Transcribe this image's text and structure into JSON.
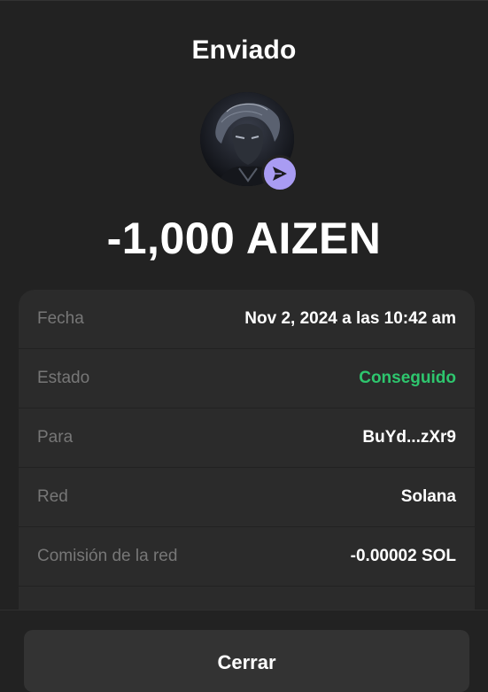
{
  "header": {
    "title": "Enviado"
  },
  "avatar": {
    "badge_icon": "send-icon"
  },
  "amount": "-1,000 AIZEN",
  "details": [
    {
      "label": "Fecha",
      "value": "Nov 2, 2024 a las 10:42 am"
    },
    {
      "label": "Estado",
      "value": "Conseguido"
    },
    {
      "label": "Para",
      "value": "BuYd...zXr9"
    },
    {
      "label": "Red",
      "value": "Solana"
    },
    {
      "label": "Comisión de la red",
      "value": "-0.00002 SOL"
    }
  ],
  "footer": {
    "close_label": "Cerrar"
  },
  "colors": {
    "background": "#222222",
    "card": "#2b2b2b",
    "success": "#2ec66e",
    "badge": "#a99cf3",
    "button": "#333333"
  }
}
